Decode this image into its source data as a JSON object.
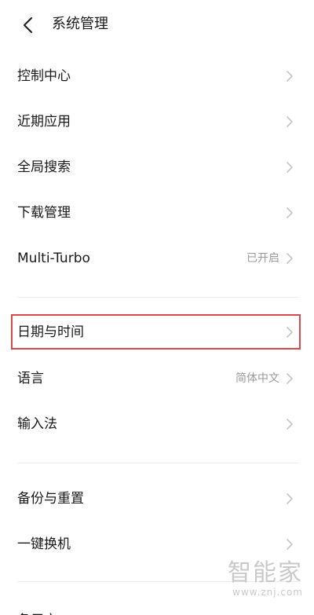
{
  "header": {
    "title": "系统管理",
    "back_icon": "chevron-left-icon"
  },
  "menu": {
    "control_center": "控制中心",
    "recent_apps": "近期应用",
    "global_search": "全局搜索",
    "download_manager": "下载管理",
    "multi_turbo": "Multi-Turbo",
    "multi_turbo_value": "已开启",
    "date_time": "日期与时间",
    "language": "语言",
    "language_value": "简体中文",
    "input_method": "输入法",
    "backup_reset": "备份与重置",
    "one_click_switch": "一键换机",
    "partial_next": "备用户"
  },
  "watermark": {
    "logo": "智能家",
    "url": "www.znj.com"
  },
  "colors": {
    "highlight": "#d9494a",
    "chevron": "#c4c4c4",
    "secondary_text": "#9a9a9a"
  }
}
